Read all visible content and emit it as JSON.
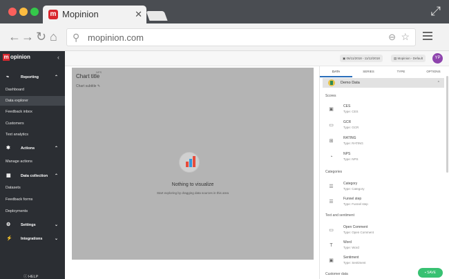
{
  "browser": {
    "tab_title": "Mopinion",
    "tab_close": "✕",
    "url": "mopinion.com"
  },
  "app": {
    "logo_text": "opinion",
    "logo_letter": "m"
  },
  "sidebar": {
    "sections": [
      {
        "label": "Reporting",
        "items": [
          "Dashboard",
          "Data explorer",
          "Feedback inbox",
          "Customers",
          "Text analytics"
        ]
      },
      {
        "label": "Actions",
        "items": [
          "Manage actions"
        ]
      },
      {
        "label": "Data collection",
        "items": [
          "Datasets",
          "Feedback forms",
          "Deployments"
        ]
      },
      {
        "label": "Settings",
        "items": []
      },
      {
        "label": "Integrations",
        "items": []
      }
    ],
    "active_item": "Data explorer",
    "help": "HELP"
  },
  "header": {
    "date_range": "06/11/2018 - 11/12/2018",
    "report": "Mopinion - Default",
    "avatar_initials": "YP"
  },
  "canvas": {
    "title": "Chart title",
    "subtitle": "Chart subtitle",
    "tooltip": "NPS",
    "empty_title": "Nothing to visualize",
    "empty_sub": "Start exploring by dragging data sources in this area"
  },
  "panel": {
    "tabs": [
      "DATA",
      "SERIES",
      "TYPE",
      "OPTIONS"
    ],
    "dataset": "Demo Data",
    "groups": [
      {
        "label": "Scores",
        "items": [
          {
            "name": "CES",
            "type": "Type: CES",
            "icon": "gauge-icon"
          },
          {
            "name": "GCR",
            "type": "Type: GCR",
            "icon": "gcr-icon"
          },
          {
            "name": "RATING",
            "type": "Type: RATING",
            "icon": "rating-icon"
          },
          {
            "name": "NPS",
            "type": "Type: NPS",
            "icon": "nps-icon"
          }
        ]
      },
      {
        "label": "Categories",
        "items": [
          {
            "name": "Category",
            "type": "Type: Category",
            "icon": "list-icon"
          },
          {
            "name": "Funnel step",
            "type": "Type: Funnel step",
            "icon": "funnel-icon"
          }
        ]
      },
      {
        "label": "Text and sentiment",
        "items": [
          {
            "name": "Open Comment",
            "type": "Type: Open Comment",
            "icon": "comment-icon"
          },
          {
            "name": "Word",
            "type": "Type: Word",
            "icon": "word-icon"
          },
          {
            "name": "Sentiment",
            "type": "Type: Sentiment",
            "icon": "sentiment-icon"
          }
        ]
      },
      {
        "label": "Customer data",
        "items": []
      }
    ],
    "save": "SAVE"
  }
}
